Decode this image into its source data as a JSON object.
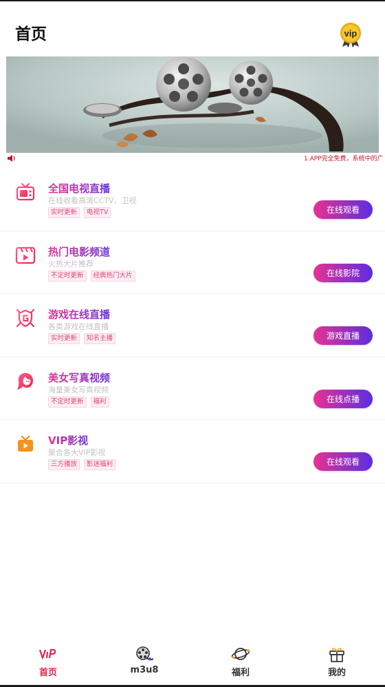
{
  "header": {
    "title": "首页",
    "vip_badge_text": "vip"
  },
  "ticker": {
    "text": "1.APP完全免费，系统中的广"
  },
  "items": [
    {
      "title": "全国电视直播",
      "subtitle": "在线收看高清CCTV、卫视",
      "tags": [
        "实时更新",
        "电视TV"
      ],
      "button": "在线观看",
      "icon": "tv-icon"
    },
    {
      "title": "热门电影频道",
      "subtitle": "火热大片推荐",
      "tags": [
        "不定时更新",
        "经典热门大片"
      ],
      "button": "在线影院",
      "icon": "movie-icon"
    },
    {
      "title": "游戏在线直播",
      "subtitle": "各类游戏在线直播",
      "tags": [
        "实时更新",
        "知名主播"
      ],
      "button": "游戏直播",
      "icon": "game-shield-icon"
    },
    {
      "title": "美女写真视频",
      "subtitle": "海量美女写真视频",
      "tags": [
        "不定时更新",
        "福利"
      ],
      "button": "在线点播",
      "icon": "woman-icon"
    },
    {
      "title": "VIP影视",
      "subtitle": "聚合各大VIP影视",
      "tags": [
        "三方播放",
        "影迷福利"
      ],
      "button": "在线观看",
      "icon": "play-tv-icon"
    }
  ],
  "tabs": [
    {
      "label": "首页",
      "icon": "vip-logo-icon",
      "active": true
    },
    {
      "label": "m3u8",
      "icon": "film-reel-icon",
      "active": false
    },
    {
      "label": "福利",
      "icon": "planet-icon",
      "active": false
    },
    {
      "label": "我的",
      "icon": "gift-icon",
      "active": false
    }
  ],
  "colors": {
    "accent_start": "#e63391",
    "accent_end": "#5b2ee0",
    "active_tab": "#e2244a",
    "ticker": "#c0152c"
  }
}
